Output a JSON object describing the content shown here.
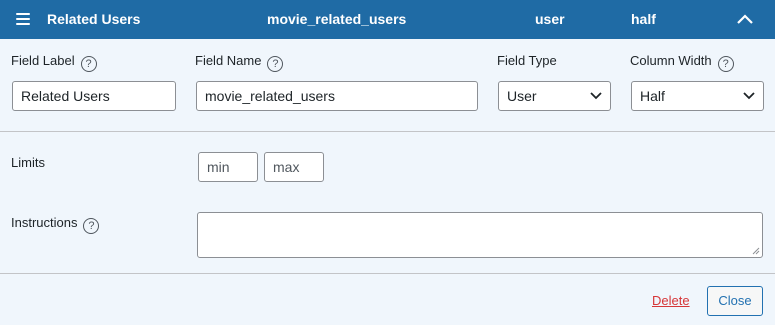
{
  "header": {
    "label": "Related Users",
    "name": "movie_related_users",
    "type": "user",
    "width": "half",
    "collapse_icon": "chevron-up-icon",
    "menu_icon": "hamburger-icon",
    "background": "#1f6ba5"
  },
  "fields": {
    "field_label": {
      "label": "Field Label",
      "value": "Related Users"
    },
    "field_name": {
      "label": "Field Name",
      "value": "movie_related_users"
    },
    "field_type": {
      "label": "Field Type",
      "value": "User"
    },
    "column_width": {
      "label": "Column Width",
      "value": "Half"
    },
    "help_glyph": "?"
  },
  "limits": {
    "label": "Limits",
    "min_placeholder": "min",
    "max_placeholder": "max"
  },
  "instructions": {
    "label": "Instructions",
    "value": ""
  },
  "footer": {
    "delete_label": "Delete",
    "close_label": "Close",
    "delete_color": "#d63638",
    "accent": "#2271b1"
  }
}
